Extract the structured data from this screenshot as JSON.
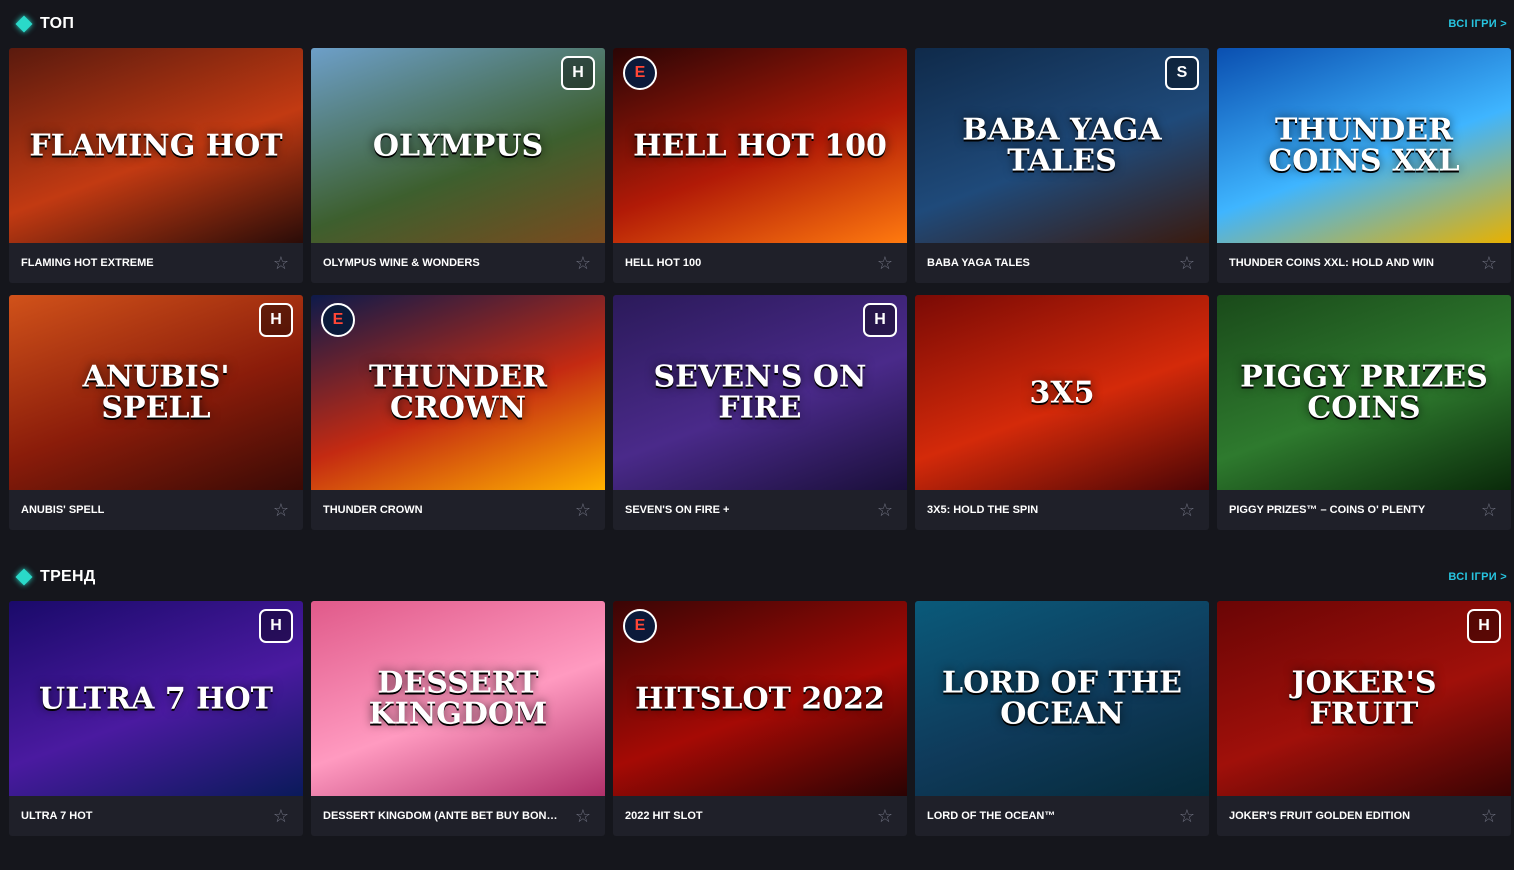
{
  "sections": [
    {
      "title": "ТОП",
      "all_link": "ВСІ ІГРИ >",
      "games": [
        {
          "name": "FLAMING HOT EXTREME",
          "art": "FLAMING HOT",
          "bg": "linear-gradient(160deg,#5a1a0e,#c23a12 55%,#2a0c08)",
          "badge": ""
        },
        {
          "name": "OLYMPUS WINE & WONDERS",
          "art": "OLYMPUS",
          "bg": "linear-gradient(160deg,#6d9fc9,#3d5f2e 60%,#7a4a1e)",
          "badge": "H"
        },
        {
          "name": "HELL HOT 100",
          "art": "HELL HOT 100",
          "bg": "linear-gradient(160deg,#2a0505,#b11a07 55%,#ff7a0f)",
          "badge": "E"
        },
        {
          "name": "BABA YAGA TALES",
          "art": "BABA YAGA TALES",
          "bg": "linear-gradient(160deg,#0f2a4a,#1f4a7a 55%,#3a1a0e)",
          "badge": "S"
        },
        {
          "name": "THUNDER COINS XXL: HOLD AND WIN",
          "art": "THUNDER COINS XXL",
          "bg": "linear-gradient(160deg,#0a4fb0,#3fb5ff 55%,#e8b100)",
          "badge": ""
        },
        {
          "name": "ANUBIS' SPELL",
          "art": "ANUBIS' SPELL",
          "bg": "linear-gradient(160deg,#d1521a,#8a1c0a 55%,#3a0a05)",
          "badge": "H"
        },
        {
          "name": "THUNDER CROWN",
          "art": "THUNDER CROWN",
          "bg": "linear-gradient(160deg,#0d1a4a,#c42a12 55%,#ffb200)",
          "badge": "E"
        },
        {
          "name": "SEVEN'S ON FIRE +",
          "art": "SEVEN'S ON FIRE",
          "bg": "linear-gradient(160deg,#2b1a5a,#4a2a8a 55%,#1a0f3a)",
          "badge": "H"
        },
        {
          "name": "3X5: HOLD THE SPIN",
          "art": "3X5",
          "bg": "linear-gradient(160deg,#7a0a05,#d42a0a 55%,#4a0505)",
          "badge": ""
        },
        {
          "name": "PIGGY PRIZES™ – COINS O' PLENTY",
          "art": "PIGGY PRIZES COINS",
          "bg": "linear-gradient(160deg,#1a4a1a,#2e7a2e 55%,#0a2a0a)",
          "badge": ""
        }
      ]
    },
    {
      "title": "ТРЕНД",
      "all_link": "ВСІ ІГРИ >",
      "games": [
        {
          "name": "ULTRA 7 HOT",
          "art": "ULTRA 7 HOT",
          "bg": "linear-gradient(160deg,#1a0a6a,#4a1aa0 55%,#0a1a5a)",
          "badge": "H"
        },
        {
          "name": "DESSERT KINGDOM (ANTE BET BUY BONUS)",
          "art": "DESSERT KINGDOM",
          "bg": "linear-gradient(160deg,#e05a8a,#ff9ac0 55%,#b0306a)",
          "badge": ""
        },
        {
          "name": "2022 HIT SLOT",
          "art": "HITSLOT 2022",
          "bg": "linear-gradient(160deg,#3a0505,#a50a05 55%,#2a0303)",
          "badge": "E"
        },
        {
          "name": "LORD OF THE OCEAN™",
          "art": "LORD OF THE OCEAN",
          "bg": "linear-gradient(160deg,#0a5a7a,#0f3a5a 55%,#052a3a)",
          "badge": ""
        },
        {
          "name": "JOKER'S FRUIT GOLDEN EDITION",
          "art": "JOKER'S FRUIT",
          "bg": "linear-gradient(160deg,#6a0505,#a0100a 55%,#3a0303)",
          "badge": "H"
        }
      ]
    }
  ],
  "colors": {
    "accent": "#2ad9c9",
    "link": "#27c5e0",
    "card_bg": "#1f2029",
    "page_bg": "#15161c"
  },
  "icons": {
    "section_marker": "diamond-icon",
    "favorite": "star-icon",
    "favorite_glyph": "☆"
  }
}
